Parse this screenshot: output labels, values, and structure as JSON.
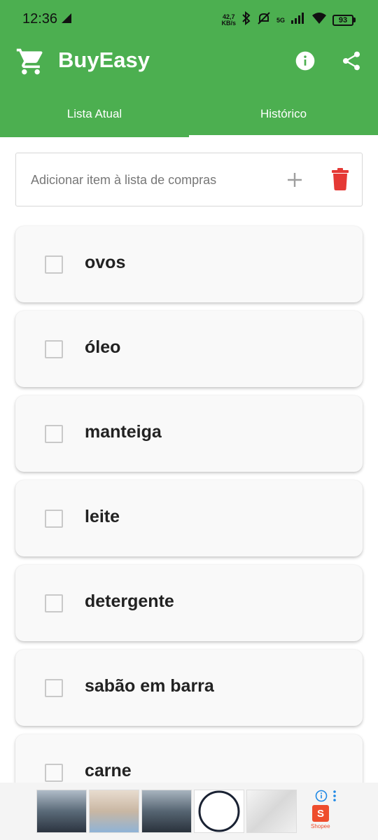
{
  "status_bar": {
    "time": "12:36",
    "net_speed_value": "42,7",
    "net_speed_unit": "KB/s",
    "network": "5G",
    "battery": "93"
  },
  "app": {
    "title": "BuyEasy",
    "brand_color": "#4caf50",
    "delete_color": "#e53935"
  },
  "tabs": [
    {
      "label": "Lista Atual",
      "selected": false
    },
    {
      "label": "Histórico",
      "selected": true
    }
  ],
  "add_item": {
    "placeholder": "Adicionar item à lista de compras",
    "value": ""
  },
  "items": [
    {
      "label": "ovos",
      "checked": false
    },
    {
      "label": "óleo",
      "checked": false
    },
    {
      "label": "manteiga",
      "checked": false
    },
    {
      "label": "leite",
      "checked": false
    },
    {
      "label": "detergente",
      "checked": false
    },
    {
      "label": "sabão em barra",
      "checked": false
    },
    {
      "label": "carne",
      "checked": false
    }
  ],
  "ad": {
    "advertiser": "Shopee",
    "icons": [
      "info-icon",
      "more-vert-icon",
      "shopee-bag-icon"
    ]
  }
}
